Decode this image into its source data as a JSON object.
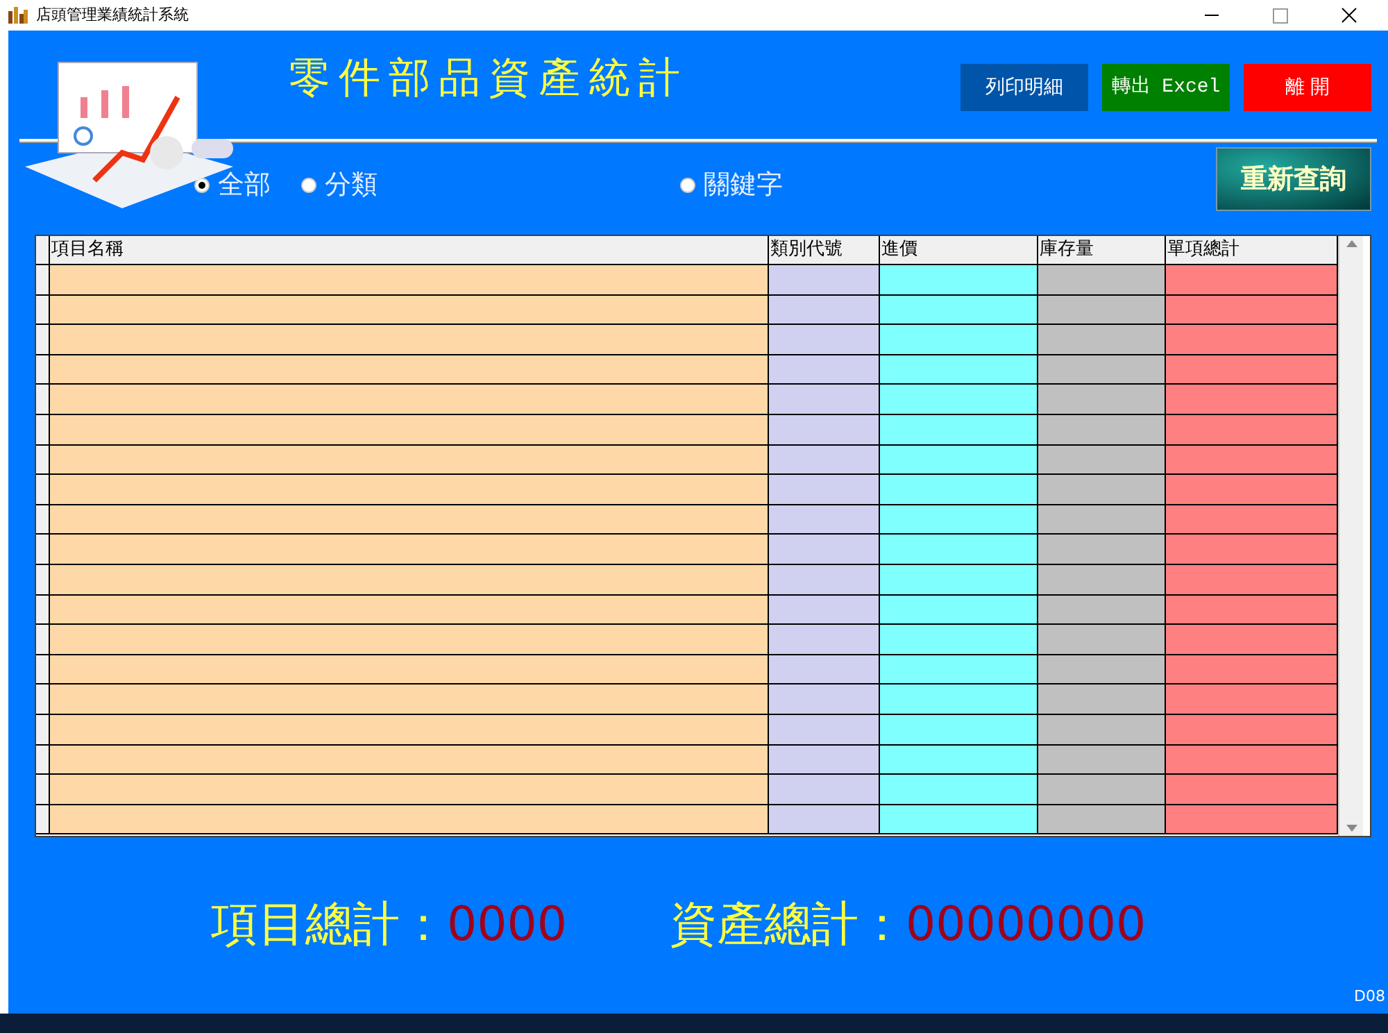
{
  "window": {
    "title": "店頭管理業績統計系統"
  },
  "header": {
    "title": "零件部品資產統計",
    "buttons": [
      {
        "label": "列印明細",
        "kind": "print"
      },
      {
        "label": "轉出 Excel",
        "kind": "export"
      },
      {
        "label": "離 開",
        "kind": "exit"
      }
    ]
  },
  "filters": [
    {
      "label": "全部",
      "selected": true
    },
    {
      "label": "分類",
      "selected": false
    },
    {
      "label": "關鍵字",
      "selected": false
    }
  ],
  "requery_button": {
    "label": "重新查詢"
  },
  "table": {
    "columns": [
      {
        "label": "項目名稱",
        "color": "#ffd8a8"
      },
      {
        "label": "類別代號",
        "color": "#d0d0f0"
      },
      {
        "label": "進價",
        "color": "#80ffff"
      },
      {
        "label": "庫存量",
        "color": "#c0c0c0"
      },
      {
        "label": "單項總計",
        "color": "#ff8080"
      }
    ]
  },
  "totals": [
    {
      "label": "項目總計：",
      "value": "0000"
    },
    {
      "label": "資產總計：",
      "value": "00000000"
    }
  ],
  "form_code": "D08"
}
